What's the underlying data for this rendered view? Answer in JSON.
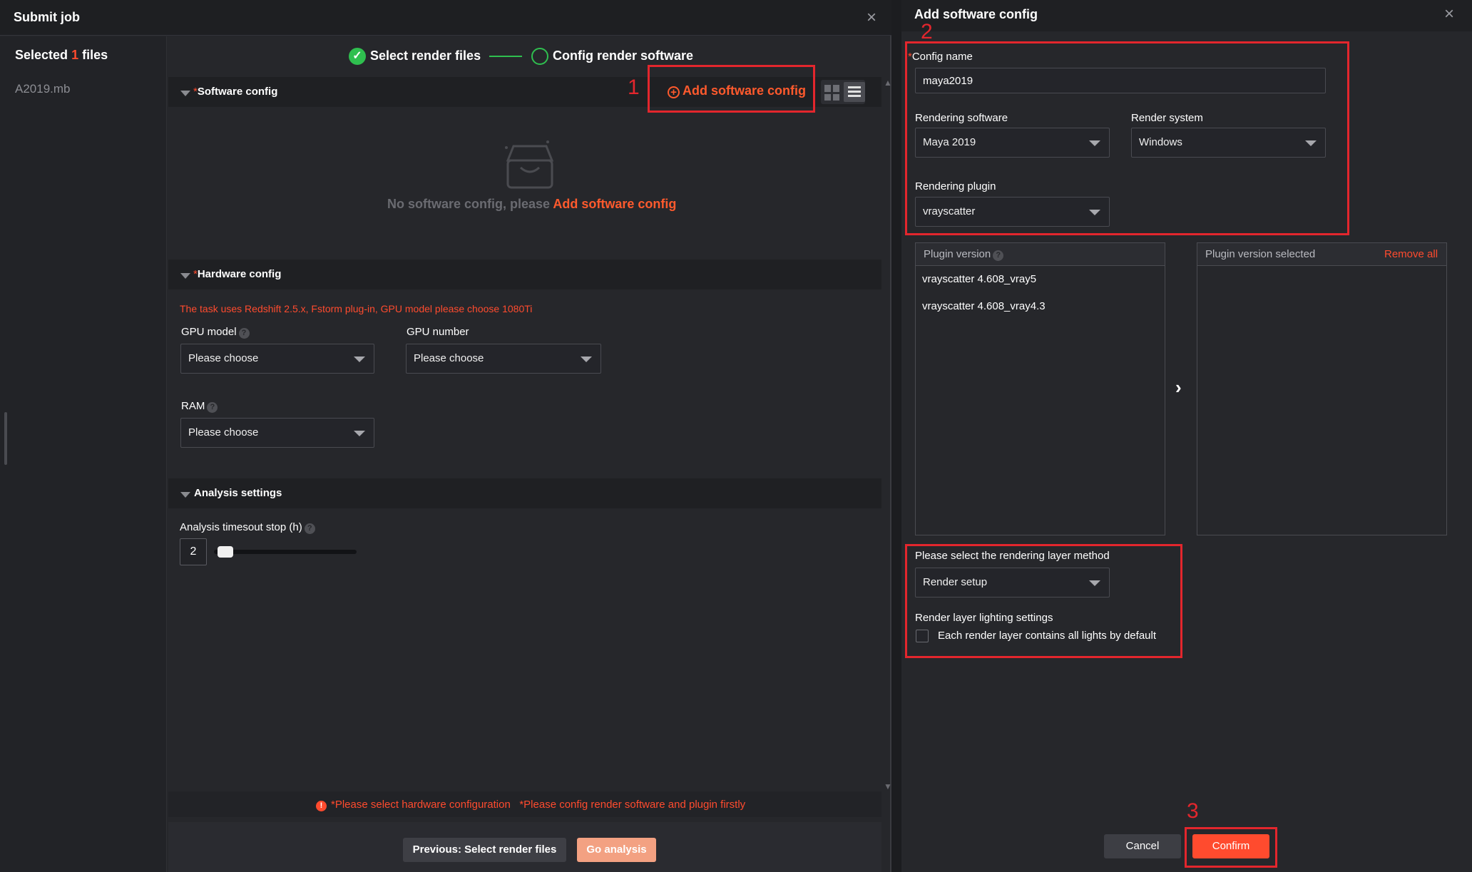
{
  "left_modal": {
    "title": "Submit job",
    "files": {
      "prefix": "Selected",
      "count": "1",
      "suffix": "files",
      "items": [
        "A2019.mb"
      ]
    },
    "steps": [
      {
        "label": "Select render files",
        "status": "done"
      },
      {
        "label": "Config render software",
        "status": "current"
      }
    ],
    "software_section": {
      "title": "Software config",
      "add_button": "Add software config",
      "empty_text": "No software config, please",
      "empty_link": "Add software config"
    },
    "hardware_section": {
      "title": "Hardware config",
      "warning": "The task uses Redshift 2.5.x, Fstorm plug-in, GPU model please choose 1080Ti",
      "gpu_model_label": "GPU model",
      "gpu_model_value": "Please choose",
      "gpu_number_label": "GPU number",
      "gpu_number_value": "Please choose",
      "ram_label": "RAM",
      "ram_value": "Please choose"
    },
    "analysis_section": {
      "title": "Analysis settings",
      "timeout_label": "Analysis timesout stop (h)",
      "timeout_value": "2",
      "timeout_slider_fraction": 0.03
    },
    "footer": {
      "error_1": "*Please select hardware configuration",
      "error_2": "*Please config render software and plugin firstly",
      "prev_button": "Previous: Select render files",
      "go_button": "Go analysis"
    }
  },
  "right_panel": {
    "title": "Add software config",
    "config_name_label": "Config name",
    "config_name_value": "maya2019",
    "rendering_software_label": "Rendering software",
    "rendering_software_value": "Maya 2019",
    "render_system_label": "Render system",
    "render_system_value": "Windows",
    "rendering_plugin_label": "Rendering plugin",
    "rendering_plugin_value": "vrayscatter",
    "plugin_version_label": "Plugin version",
    "plugin_versions": [
      "vrayscatter 4.608_vray5",
      "vrayscatter 4.608_vray4.3"
    ],
    "plugin_version_selected_label": "Plugin version selected",
    "remove_all": "Remove all",
    "layer_method_label": "Please select the rendering layer method",
    "layer_method_value": "Render setup",
    "lighting_label": "Render layer lighting settings",
    "lighting_checkbox_label": "Each render layer contains all lights by default",
    "lighting_checked": false,
    "cancel_button": "Cancel",
    "confirm_button": "Confirm"
  },
  "annotations": {
    "markers": [
      "1",
      "2",
      "3"
    ]
  },
  "colors": {
    "accent": "#ff4b2e",
    "success": "#2fbf4f",
    "highlight_box": "#e3262d"
  }
}
